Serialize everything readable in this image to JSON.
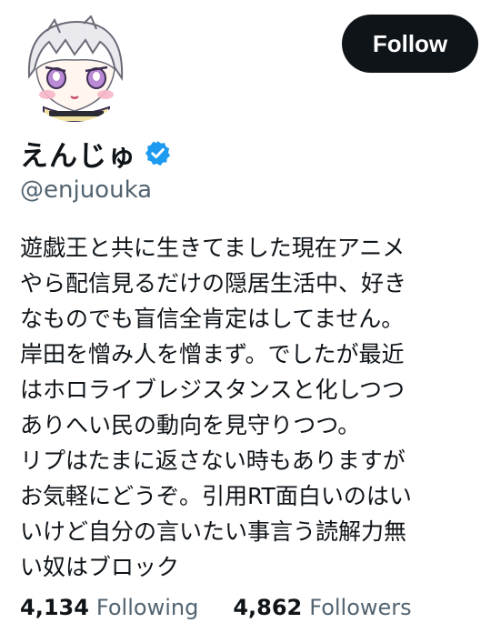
{
  "profile": {
    "display_name": "えんじゅ",
    "handle": "@enjuouka",
    "verified_icon": "verified-badge-icon",
    "avatar_icon": "anime-avatar-icon"
  },
  "actions": {
    "follow_label": "Follow"
  },
  "bio": {
    "lines": [
      "遊戯王と共に生きてました現在アニメ",
      "やら配信見るだけの隠居生活中、好き",
      "なものでも盲信全肯定はしてません。",
      "岸田を憎み人を憎まず。でしたが最近",
      "はホロライブレジスタンスと化しつつ",
      "ありへい民の動向を見守りつつ。",
      "リプはたまに返さない時もありますが",
      "お気軽にどうぞ。引用RT面白いのはい",
      "いけど自分の言いたい事言う読解力無",
      "い奴はブロック"
    ]
  },
  "stats": {
    "following_count": "4,134",
    "following_label": "Following",
    "followers_count": "4,862",
    "followers_label": "Followers"
  },
  "colors": {
    "text": "#0f1419",
    "secondary": "#536471",
    "verified": "#1d9bf0",
    "button_bg": "#0f1419",
    "button_text": "#ffffff"
  }
}
